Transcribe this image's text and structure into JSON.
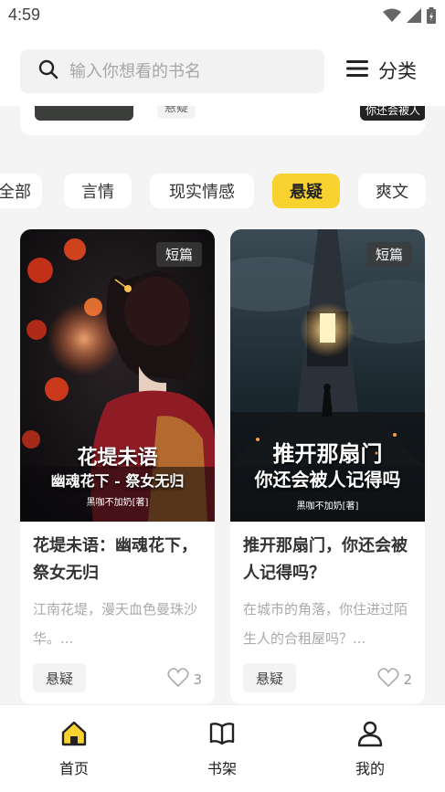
{
  "status": {
    "time": "4:59"
  },
  "search": {
    "placeholder": "输入你想看的书名"
  },
  "header": {
    "category_label": "分类"
  },
  "prev_card": {
    "tag": "悬疑",
    "thumb_text": "你还会被人"
  },
  "chips": [
    "全部",
    "言情",
    "现实情感",
    "悬疑",
    "爽文"
  ],
  "active_chip": "悬疑",
  "books": [
    {
      "badge": "短篇",
      "cover_line1": "花堤未语",
      "cover_line2": "幽魂花下 - 祭女无归",
      "cover_studio": "黑咖不加奶[著]",
      "title": "花堤未语：幽魂花下，祭女无归",
      "desc": "江南花堤，漫天血色曼珠沙华。...",
      "tag": "悬疑",
      "likes": "3"
    },
    {
      "badge": "短篇",
      "cover_line1": "推开那扇门",
      "cover_line2": "你还会被人记得吗",
      "cover_studio": "黑咖不加奶[著]",
      "title": "推开那扇门，你还会被人记得吗？",
      "desc": "在城市的角落，你住进过陌生人的合租屋吗？...",
      "tag": "悬疑",
      "likes": "2"
    }
  ],
  "nav": {
    "home": "首页",
    "shelf": "书架",
    "mine": "我的"
  },
  "colors": {
    "accent": "#f8d22f",
    "background": "#f4f4f4"
  },
  "icons": [
    "wifi-icon",
    "signal-icon",
    "battery-icon",
    "search-icon",
    "menu-icon",
    "heart-icon",
    "home-icon",
    "book-icon",
    "user-icon"
  ]
}
